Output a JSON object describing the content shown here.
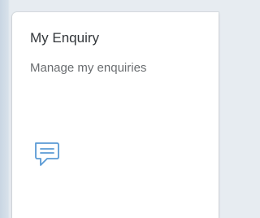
{
  "tile": {
    "title": "My Enquiry",
    "subtitle": "Manage my enquiries",
    "icon": "chat-bubble-icon",
    "icon_color": "#5b9bd5"
  }
}
